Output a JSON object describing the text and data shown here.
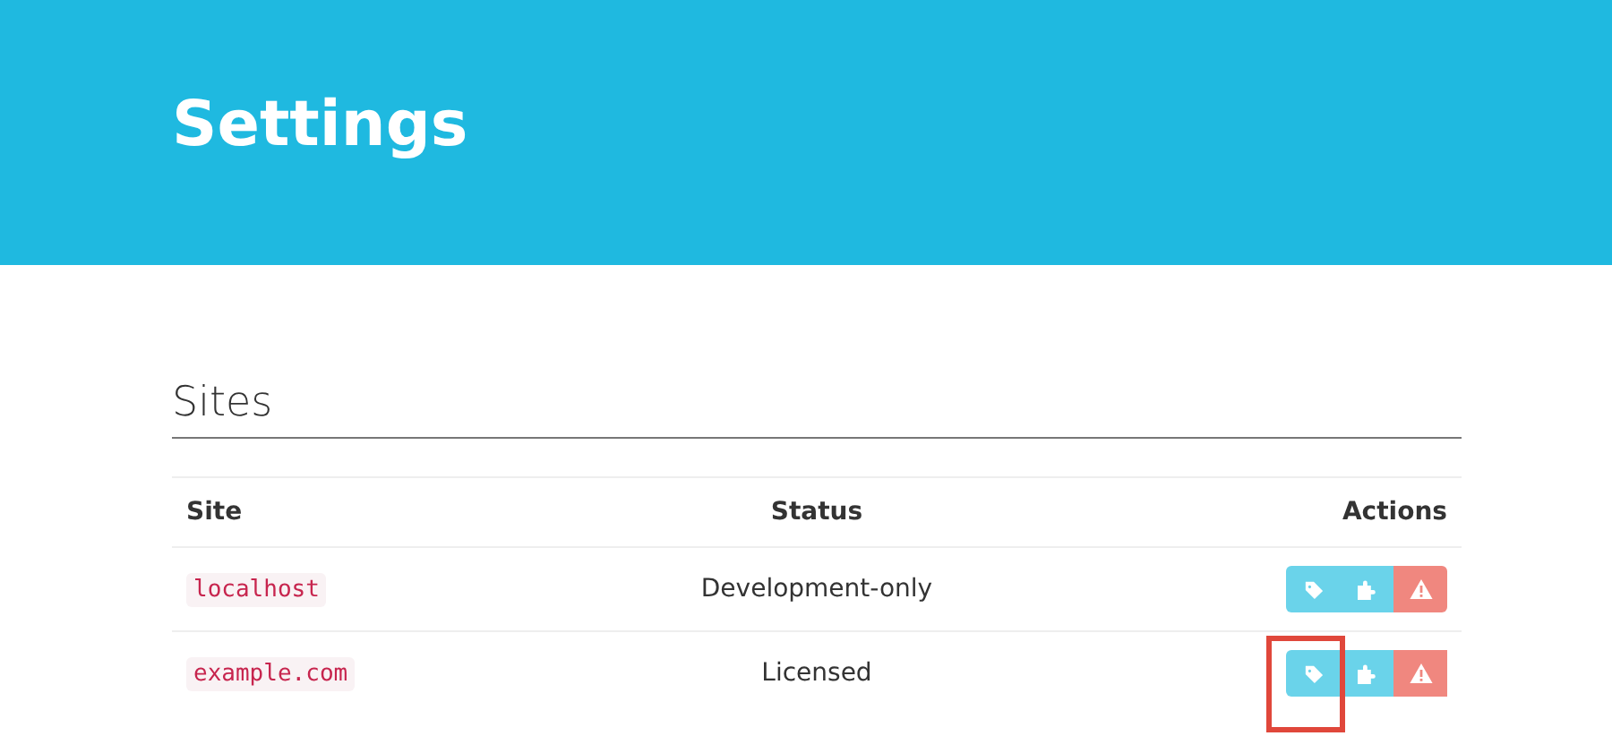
{
  "header": {
    "title": "Settings"
  },
  "section": {
    "title": "Sites"
  },
  "table": {
    "columns": [
      "Site",
      "Status",
      "Actions"
    ],
    "rows": [
      {
        "site": "localhost",
        "status": "Development-only",
        "actions": [
          {
            "kind": "tag",
            "highlighted": false
          },
          {
            "kind": "plugin",
            "highlighted": false
          },
          {
            "kind": "warning",
            "highlighted": false
          }
        ]
      },
      {
        "site": "example.com",
        "status": "Licensed",
        "actions": [
          {
            "kind": "tag",
            "highlighted": true
          },
          {
            "kind": "plugin",
            "highlighted": false
          },
          {
            "kind": "warning",
            "highlighted": false
          }
        ]
      }
    ]
  }
}
